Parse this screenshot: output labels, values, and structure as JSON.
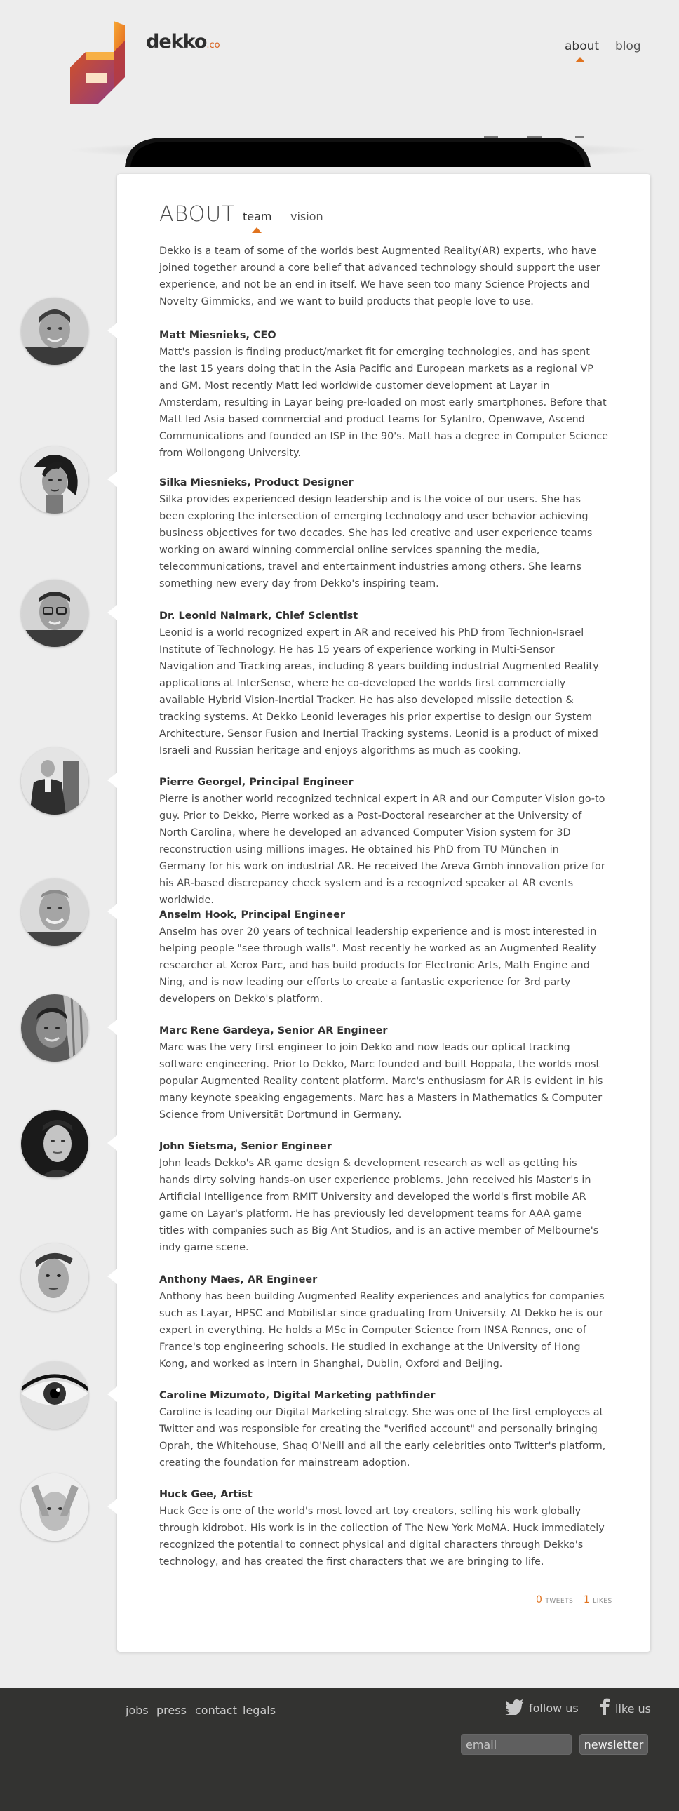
{
  "header": {
    "logo_text": "dekko",
    "logo_suffix": ".co",
    "nav": [
      {
        "label": "about"
      },
      {
        "label": "blog"
      }
    ]
  },
  "about": {
    "title": "ABOUT",
    "tabs": [
      {
        "label": "team"
      },
      {
        "label": "vision"
      }
    ],
    "intro": "Dekko is a team of some of the worlds best Augmented Reality(AR) experts, who have joined together around a core belief that advanced technology should support the user experience, and not be an end in itself. We have seen too many Science Projects and Novelty Gimmicks, and we want to build products that people love to use."
  },
  "team": [
    {
      "name": "Matt Miesnieks, CEO",
      "bio": "Matt's passion is finding product/market fit for emerging technologies, and has spent the last 15 years doing that in the Asia Pacific and European markets as a regional VP and GM. Most recently Matt led worldwide customer development at Layar in Amsterdam, resulting in Layar being pre-loaded on most early smartphones. Before that Matt led Asia based commercial and product teams for Sylantro, Openwave, Ascend Communications and founded an ISP in the 90's. Matt has a degree in Computer Science from Wollongong University."
    },
    {
      "name": "Silka Miesnieks, Product Designer",
      "bio": "Silka provides experienced design leadership and is the voice of our users. She has been exploring the intersection of emerging technology and user behavior achieving business objectives for two decades. She has led creative and user experience teams working on award winning commercial online services spanning the media, telecommunications, travel and entertainment industries among others. She learns something new every day from Dekko's inspiring team."
    },
    {
      "name": "Dr. Leonid Naimark, Chief Scientist",
      "bio": "Leonid is a world recognized expert in AR and received his PhD from Technion-Israel Institute of Technology. He has 15 years of experience working in Multi-Sensor Navigation and Tracking areas, including 8 years building industrial Augmented Reality applications at InterSense, where he co-developed the worlds first commercially available Hybrid Vision-Inertial Tracker. He has also developed missile detection & tracking systems. At Dekko Leonid leverages his prior expertise to design our System Architecture, Sensor Fusion and Inertial Tracking systems. Leonid is a product of mixed Israeli and Russian heritage and enjoys algorithms as much as cooking."
    },
    {
      "name": "Pierre Georgel, Principal Engineer",
      "bio": "Pierre is another world recognized technical expert in AR and our Computer Vision go-to guy. Prior to Dekko, Pierre worked as a Post-Doctoral researcher at the University of North Carolina, where he developed an advanced Computer Vision system for 3D reconstruction using millions images. He obtained his PhD from TU München in Germany for his work on industrial AR. He received the Areva Gmbh innovation prize for his AR-based discrepancy check system and is a recognized speaker at AR events worldwide."
    },
    {
      "name": "Anselm Hook, Principal Engineer",
      "bio": "Anselm has over 20 years of technical leadership experience and is most interested in helping people \"see through walls\". Most recently he worked as an Augmented Reality researcher at Xerox Parc, and has build products for Electronic Arts, Math Engine and Ning, and is now leading our efforts to create a fantastic experience for 3rd party developers on Dekko's platform."
    },
    {
      "name": "Marc Rene Gardeya, Senior AR Engineer",
      "bio": "Marc was the very first engineer to join Dekko and now leads our optical tracking software engineering. Prior to Dekko, Marc founded and built Hoppala, the worlds most popular Augmented Reality content platform. Marc's enthusiasm for AR is evident in his many keynote speaking engagements. Marc has a Masters in Mathematics & Computer Science from Universität Dortmund in Germany."
    },
    {
      "name": "John Sietsma, Senior Engineer",
      "bio": "John leads Dekko's AR game design & development research as well as getting his hands dirty solving hands-on user experience problems. John received his Master's in Artificial Intelligence from RMIT University and developed the world's first mobile AR game on Layar's platform. He has previously led development teams for AAA game titles with companies such as Big Ant Studios, and is an active member of Melbourne's indy game scene."
    },
    {
      "name": "Anthony Maes, AR Engineer",
      "bio": "Anthony has been building Augmented Reality experiences and analytics for companies such as Layar, HPSC and Mobilistar since graduating from University. At Dekko he is our expert in everything. He holds a MSc in Computer Science from INSA Rennes, one of France's top engineering schools. He studied in exchange at the University of Hong Kong, and worked as intern in Shanghai, Dublin, Oxford and Beijing."
    },
    {
      "name": "Caroline Mizumoto, Digital Marketing pathfinder",
      "bio": "Caroline is leading our Digital Marketing strategy. She was one of the first employees at Twitter and was responsible for creating the \"verified account\" and personally bringing Oprah, the Whitehouse, Shaq O'Neill and all the early celebrities onto Twitter's platform, creating the foundation for mainstream adoption."
    },
    {
      "name": "Huck Gee, Artist",
      "bio": "Huck Gee is one of the world's most loved art toy creators, selling his work globally through kidrobot. His work is in the collection of The New York MoMA. Huck immediately recognized the potential to connect physical and digital characters through Dekko's technology, and has created the first characters that we are bringing to life."
    }
  ],
  "social": {
    "tweets_count": "0",
    "tweets_label": "TWEETS",
    "likes_count": "1",
    "likes_label": "LIKES"
  },
  "footer": {
    "links": [
      {
        "label": "jobs"
      },
      {
        "label": "press"
      },
      {
        "label": "contact"
      },
      {
        "label": "legals"
      }
    ],
    "follow_label": "follow us",
    "like_label": "like us",
    "email_placeholder": "email",
    "newsletter_label": "newsletter"
  },
  "colors": {
    "accent": "#e0731f",
    "footer_bg": "#333331",
    "page_bg": "#ededed"
  }
}
